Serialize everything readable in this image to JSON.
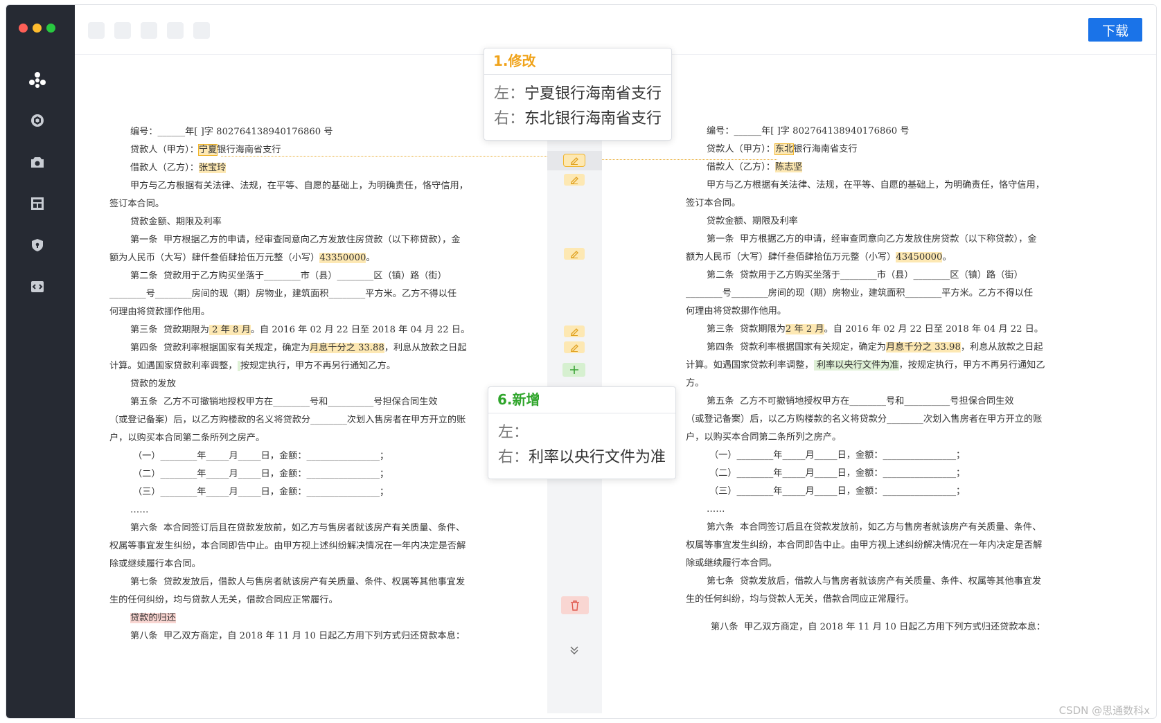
{
  "toolbar": {
    "download_label": "下载"
  },
  "colors": {
    "sidebar_bg": "#262a33",
    "accent": "#1a73e8",
    "modify": "#f0b429",
    "add": "#3aa335",
    "delete": "#f9d6d2"
  },
  "sidebar": {
    "icons": [
      "logo-icon",
      "cube-icon",
      "camera-icon",
      "layout-icon",
      "shield-icon",
      "code-icon"
    ]
  },
  "left_doc": {
    "l01": "编号：______年[ ]字 802764138940176860 号",
    "l02a": "贷款人（甲方）：",
    "l02b": "宁夏",
    "l02c": "银行海南省支行",
    "l03a": "借款人（乙方）：",
    "l03b": "张宝玲",
    "l04": "甲方与乙方根据有关法律、法规，在平等、自愿的基础上，为明确责任，恪守信用，",
    "l05": "签订本合同。",
    "l06": "贷款金额、期限及利率",
    "l07": "第一条  甲方根据乙方的申请，经审查同意向乙方发放住房贷款（以下称贷款），金",
    "l08a": "额为人民币（大写）肆仟叁佰肆拾伍万元整（小写）",
    "l08b": "43350000",
    "l08c": "。",
    "l09": "第二条  贷款用于乙方购买坐落于________市（县）________区（镇）路（街）",
    "l10": "________号________房间的现（期）房物业，建筑面积________平方米。乙方不得以任",
    "l11": "何理由将贷款挪作他用。",
    "l12a": "第三条  贷款期限为",
    "l12b": " 2 年 8 月",
    "l12c": "。自 2016 年 02 月 22 日至 2018 年 04 月 22 日。",
    "l13a": "第四条  贷款利率根据国家有关规定，确定为",
    "l13b": "月息千分之 33.88",
    "l13c": "，利息从放款之日起",
    "l14a": "计算。如遇国家贷款利率调整，",
    "l14b": " ",
    "l14c": "按规定执行，甲方不再另行通知乙方。",
    "l15": "贷款的发放",
    "l16": "第五条  乙方不可撤销地授权甲方在________号和__________号担保合同生效",
    "l17": "（或登记备案）后，以乙方购楼款的名义将贷款分________次划入售房者在甲方开立的账",
    "l18": "户，以购买本合同第二条所列之房产。",
    "l19": "（一）________年_____月_____日，金额：________________；",
    "l20": "（二）________年_____月_____日，金额：________________；",
    "l21": "（三）________年_____月_____日，金额：________________；",
    "l22": "……",
    "l23": "第六条  本合同签订后且在贷款发放前，如乙方与售房者就该房产有关质量、条件、",
    "l24": "权属等事宜发生纠纷，本合同即告中止。由甲方视上述纠纷解决情况在一年内决定是否解",
    "l25": "除或继续履行本合同。",
    "l26": "第七条  贷款发放后，借款人与售房者就该房产有关质量、条件、权属等其他事宜发",
    "l27": "生的任何纠纷，均与贷款人无关，借款合同应正常履行。",
    "l28": "贷款的归还",
    "l29": "第八条  甲乙双方商定，自 2018 年 11 月 10 日起乙方用下列方式归还贷款本息："
  },
  "right_doc": {
    "r01": "编号：______年[ ]字 802764138940176860 号",
    "r02a": "贷款人（甲方）：",
    "r02b": "东北",
    "r02c": "银行海南省支行",
    "r03a": "借款人（乙方）：",
    "r03b": "陈志坚",
    "r04": "甲方与乙方根据有关法律、法规，在平等、自愿的基础上，为明确责任，恪守信用，",
    "r05": "签订本合同。",
    "r06": "贷款金额、期限及利率",
    "r07": "第一条  甲方根据乙方的申请，经审查同意向乙方发放住房贷款（以下称贷款），金",
    "r08a": "额为人民币（大写）肆仟叁佰肆拾伍万元整（小写）",
    "r08b": "43450000",
    "r08c": "。",
    "r09": "第二条  贷款用于乙方购买坐落于________市（县）________区（镇）路（街）",
    "r10": "________号________房间的现（期）房物业，建筑面积________平方米。乙方不得以任",
    "r11": "何理由将贷款挪作他用。",
    "r12a": "第三条  贷款期限为",
    "r12b": "2 年 2 月",
    "r12c": "。自 2016 年 02 月 22 日至 2018 年 04 月 22 日。",
    "r13a": "第四条  贷款利率根据国家有关规定，确定为",
    "r13b": "月息千分之 33.98",
    "r13c": "，利息从放款之日起",
    "r14a": "计算。如遇国家贷款利率调整，",
    "r14b": " 利率以央行文件为准",
    "r14c": "，按规定执行，甲方不再另行通知乙",
    "r15": "方。",
    "r16": "第五条  乙方不可撤销地授权甲方在________号和__________号担保合同生效",
    "r17": "（或登记备案）后，以乙方购楼款的名义将贷款分________次划入售房者在甲方开立的账",
    "r18": "户，以购买本合同第二条所列之房产。",
    "r19": "（一）________年_____月_____日，金额：________________；",
    "r20": "（二）________年_____月_____日，金额：________________；",
    "r21": "（三）________年_____月_____日，金额：________________；",
    "r22": "……",
    "r23": "第六条  本合同签订后且在贷款发放前，如乙方与售房者就该房产有关质量、条件、",
    "r24": "权属等事宜发生纠纷，本合同即告中止。由甲方视上述纠纷解决情况在一年内决定是否解",
    "r25": "除或继续履行本合同。",
    "r26": "第七条  贷款发放后，借款人与售房者就该房产有关质量、条件、权属等其他事宜发",
    "r27": "生的任何纠纷，均与贷款人无关，借款合同应正常履行。",
    "r29": "第八条  甲乙双方商定，自 2018 年 11 月 10 日起乙方用下列方式归还贷款本息："
  },
  "popup_modify": {
    "title": "1.修改",
    "left_label": "左：",
    "left_value": "宁夏银行海南省支行",
    "right_label": "右：",
    "right_value": "东北银行海南省支行"
  },
  "popup_add": {
    "title": "6.新增",
    "left_label": "左：",
    "left_value": "",
    "right_label": "右：",
    "right_value": "利率以央行文件为准"
  },
  "watermark": "CSDN @思通数科x"
}
